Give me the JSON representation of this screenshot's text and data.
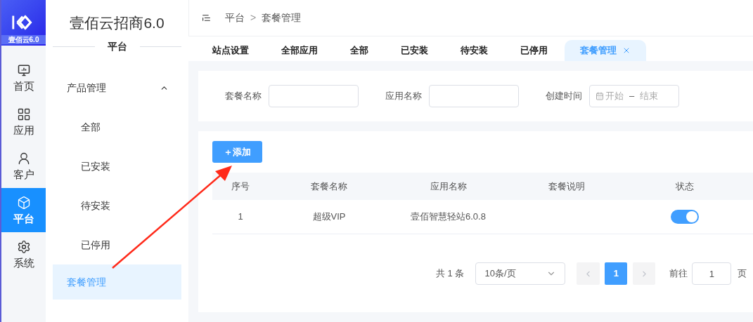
{
  "logo": {
    "caption": "壹佰云6.0"
  },
  "rail": [
    {
      "label": "首页",
      "selected": false
    },
    {
      "label": "应用",
      "selected": false
    },
    {
      "label": "客户",
      "selected": false
    },
    {
      "label": "平台",
      "selected": true
    },
    {
      "label": "系统",
      "selected": false
    }
  ],
  "sidebar": {
    "title": "壹佰云招商6.0",
    "section": "平台",
    "group": {
      "label": "产品管理",
      "expanded": true,
      "children": [
        {
          "label": "全部",
          "selected": false
        },
        {
          "label": "已安装",
          "selected": false
        },
        {
          "label": "待安装",
          "selected": false
        },
        {
          "label": "已停用",
          "selected": false
        }
      ]
    },
    "items": [
      {
        "label": "套餐管理",
        "selected": true
      }
    ]
  },
  "breadcrumb": [
    "平台",
    "套餐管理"
  ],
  "breadcrumb_separator": ">",
  "tabs": [
    {
      "label": "站点设置",
      "selected": false,
      "closable": false
    },
    {
      "label": "全部应用",
      "selected": false,
      "closable": false
    },
    {
      "label": "全部",
      "selected": false,
      "closable": false
    },
    {
      "label": "已安装",
      "selected": false,
      "closable": false
    },
    {
      "label": "待安装",
      "selected": false,
      "closable": false
    },
    {
      "label": "已停用",
      "selected": false,
      "closable": false
    },
    {
      "label": "套餐管理",
      "selected": true,
      "closable": true
    }
  ],
  "filters": [
    {
      "label": "套餐名称",
      "kind": "text"
    },
    {
      "label": "应用名称",
      "kind": "text"
    },
    {
      "label": "创建时间",
      "kind": "daterange",
      "start_placeholder": "开始",
      "end_placeholder": "结束",
      "separator": "–"
    }
  ],
  "add_button": "＋添加",
  "table": {
    "columns": [
      "序号",
      "套餐名称",
      "应用名称",
      "套餐说明",
      "状态"
    ],
    "rows": [
      {
        "cells": [
          "1",
          "超级VIP",
          "壹佰智慧轻站6.0.8"
        ],
        "on": true
      }
    ]
  },
  "pagination": {
    "total": "共 1 条",
    "page_size": "10条/页",
    "pages": [
      {
        "label": "1",
        "selected": true
      }
    ],
    "goto_label": "前往",
    "goto_value": "1",
    "goto_suffix": "页"
  }
}
